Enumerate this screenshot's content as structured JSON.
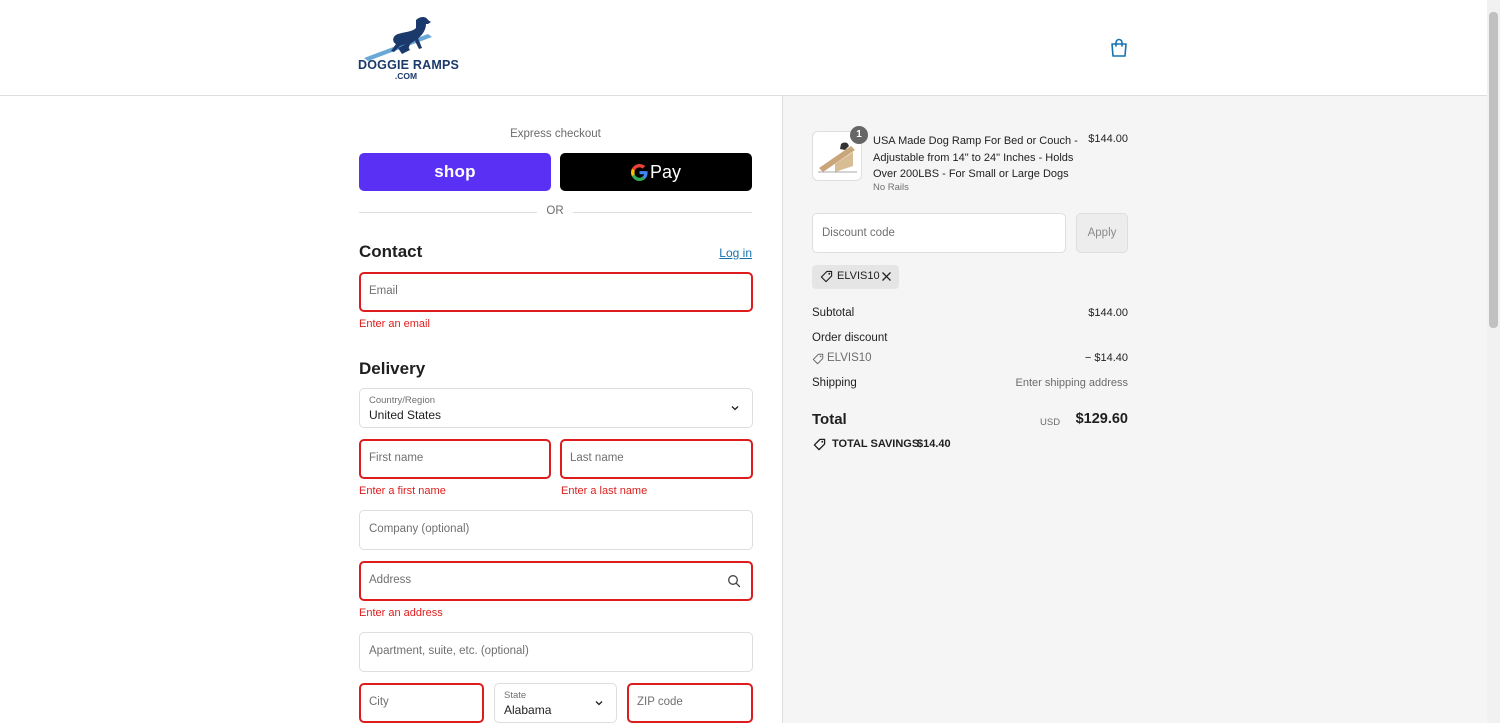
{
  "header": {
    "logo_text": "DOGGIE RAMPS",
    "logo_subtext": ".COM",
    "cart_icon": "shopping-bag-icon"
  },
  "express": {
    "label": "Express checkout",
    "shop_label": "shop",
    "gpay_label": "Pay",
    "or": "OR"
  },
  "contact": {
    "heading": "Contact",
    "login_label": "Log in",
    "email_placeholder": "Email",
    "email_error": "Enter an email"
  },
  "delivery": {
    "heading": "Delivery",
    "country_label": "Country/Region",
    "country_value": "United States",
    "first_name_placeholder": "First name",
    "first_name_error": "Enter a first name",
    "last_name_placeholder": "Last name",
    "last_name_error": "Enter a last name",
    "company_placeholder": "Company (optional)",
    "address_placeholder": "Address",
    "address_error": "Enter an address",
    "apartment_placeholder": "Apartment, suite, etc. (optional)",
    "city_placeholder": "City",
    "state_label": "State",
    "state_value": "Alabama",
    "zip_placeholder": "ZIP code"
  },
  "summary": {
    "product": {
      "quantity": "1",
      "name": "USA Made Dog Ramp For Bed or Couch - Adjustable from 14\" to 24\" Inches - Holds Over 200LBS - For Small or Large Dogs",
      "variant": "No Rails",
      "price": "$144.00"
    },
    "discount_placeholder": "Discount code",
    "apply_label": "Apply",
    "applied_code": "ELVIS10",
    "subtotal_label": "Subtotal",
    "subtotal_value": "$144.00",
    "order_discount_label": "Order discount",
    "order_discount_code": "ELVIS10",
    "order_discount_value": "− $14.40",
    "shipping_label": "Shipping",
    "shipping_value": "Enter shipping address",
    "total_label": "Total",
    "total_currency": "USD",
    "total_value": "$129.60",
    "savings_label": "TOTAL SAVINGS",
    "savings_value": "$14.40"
  },
  "colors": {
    "error": "#dd1d1d",
    "shop_pay": "#5a31f4",
    "link": "#1773b0",
    "brand_navy": "#1b3a6b"
  }
}
